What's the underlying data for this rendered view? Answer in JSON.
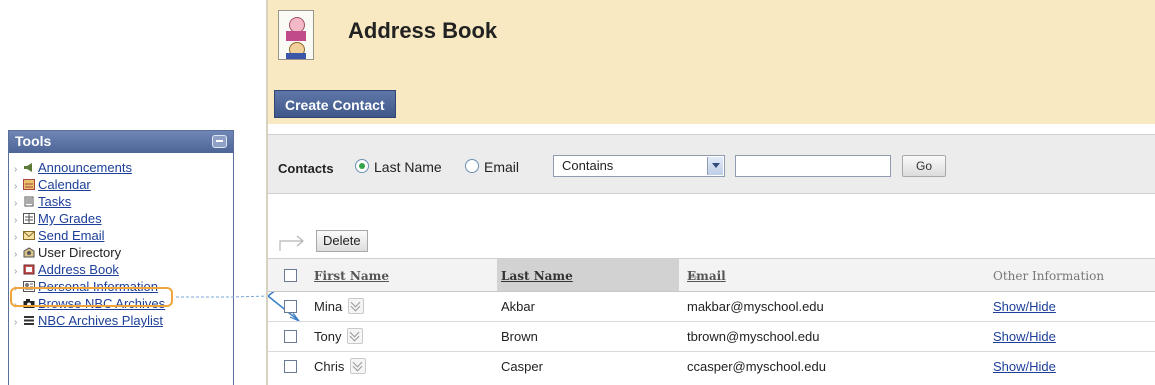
{
  "tools": {
    "title": "Tools",
    "items": [
      {
        "label": "Announcements",
        "icon": "megaphone-icon",
        "link": true
      },
      {
        "label": "Calendar",
        "icon": "calendar-icon",
        "link": true
      },
      {
        "label": "Tasks",
        "icon": "tasks-icon",
        "link": true
      },
      {
        "label": "My Grades",
        "icon": "grades-icon",
        "link": true
      },
      {
        "label": "Send Email",
        "icon": "email-icon",
        "link": true
      },
      {
        "label": "User Directory",
        "icon": "directory-icon",
        "link": false
      },
      {
        "label": "Address Book",
        "icon": "address-book-icon",
        "link": true
      },
      {
        "label": "Personal Information",
        "icon": "personal-info-icon",
        "link": true
      },
      {
        "label": "Browse NBC Archives",
        "icon": "camera-icon",
        "link": true
      },
      {
        "label": "NBC Archives Playlist",
        "icon": "playlist-icon",
        "link": true
      }
    ]
  },
  "page": {
    "title": "Address Book",
    "create_label": "Create Contact"
  },
  "search": {
    "contacts_label": "Contacts",
    "option_lastname": "Last Name",
    "option_email": "Email",
    "selected_option": "Last Name",
    "operator": "Contains",
    "value": "",
    "go_label": "Go"
  },
  "list": {
    "delete_label": "Delete",
    "headers": {
      "first": "First Name",
      "last": "Last Name",
      "email": "Email",
      "other": "Other Information"
    },
    "sort": {
      "column": "Last Name",
      "direction": "ascending"
    },
    "rows": [
      {
        "first": "Mina",
        "last": "Akbar",
        "email": "makbar@myschool.edu",
        "other": "Show/Hide"
      },
      {
        "first": "Tony",
        "last": "Brown",
        "email": "tbrown@myschool.edu",
        "other": "Show/Hide"
      },
      {
        "first": "Chris",
        "last": "Casper",
        "email": "ccasper@myschool.edu",
        "other": "Show/Hide"
      }
    ]
  },
  "colors": {
    "header_bg": "#f8e9c2",
    "button_blue": "#4d6596",
    "link": "#1d3f99",
    "highlight": "#f0a53b",
    "connector": "#3c7fc4"
  }
}
